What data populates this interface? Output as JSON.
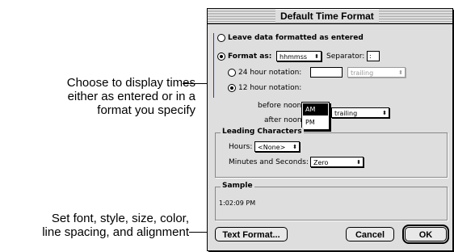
{
  "callouts": {
    "display_times": [
      "Choose to display times",
      "either as entered or in a",
      "format you specify"
    ],
    "text_format": [
      "Set font, style, size, color,",
      "line spacing, and alignment"
    ]
  },
  "dialog": {
    "title": "Default Time Format",
    "leave_as_entered": "Leave data formatted as entered",
    "format_as": "Format as:",
    "format_value": "hhmmss",
    "separator_label": "Separator:",
    "separator_value": ":",
    "notation_24": "24 hour notation:",
    "notation_24_value": "",
    "notation_24_position": "trailing",
    "notation_12": "12 hour notation:",
    "before_noon_label": "before noon:",
    "before_noon_value": "AM",
    "after_noon_label": "after noon:",
    "after_noon_value": "PM",
    "notation_12_position": "trailing",
    "leading_characters": "Leading Characters",
    "hours_label": "Hours:",
    "hours_value": "<None>",
    "minutes_label": "Minutes and Seconds:",
    "minutes_value": "Zero",
    "sample_label": "Sample",
    "sample_value": "1:02:09 PM",
    "text_format_button": "Text Format...",
    "cancel_button": "Cancel",
    "ok_button": "OK",
    "selected_option": "format_as",
    "selected_hour_notation": "12"
  },
  "icons": {
    "popup_arrow": "popup-arrows-icon"
  }
}
